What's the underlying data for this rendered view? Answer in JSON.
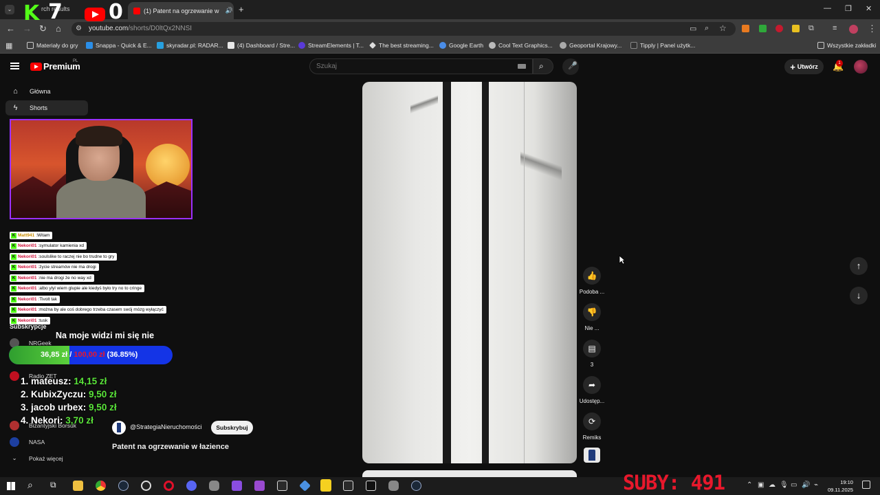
{
  "browser": {
    "tab_inactive_label": "rch results",
    "tab_active_label": "(1) Patent na ogrzewanie w",
    "url_main": "youtube.com",
    "url_path": "/shorts/D0ltQx2NNSI",
    "bookmarks": [
      "Materiały do gry",
      "Snappa - Quick & E...",
      "skyradar.pl: RADAR...",
      "(4) Dashboard / Stre...",
      "StreamElements | T...",
      "The best streaming...",
      "Google Earth",
      "Cool Text Graphics...",
      "Geoportal Krajowy...",
      "Tipply | Panel użytk..."
    ],
    "all_bookmarks": "Wszystkie zakładki"
  },
  "youtube": {
    "brand": "Premium",
    "region": "PL",
    "search_placeholder": "Szukaj",
    "create_label": "Utwórz",
    "bell_count": "1",
    "sidebar": {
      "home": "Główna",
      "shorts": "Shorts",
      "subscriptions_heading": "Subskrypcje",
      "subs": [
        "NRGeek",
        "Radio ZET",
        "Bizantyjski Borsuk",
        "NASA"
      ],
      "show_more": "Pokaż więcej"
    },
    "short": {
      "channel": "@StrategiaNieruchomości",
      "subscribe": "Subskrybuj",
      "title": "Patent na ogrzewanie w łazience"
    },
    "actions": {
      "like": "Podoba ...",
      "dislike": "Nie ...",
      "comments": "3",
      "share": "Udostęp...",
      "remix": "Remiks"
    }
  },
  "overlay": {
    "kick_count": "7",
    "kick_letter": "K",
    "yt_count": "0",
    "chat": [
      {
        "user": "Matt941",
        "msg": "Witam",
        "gold": true
      },
      {
        "user": "Nekori01",
        "msg": "symulator kamienia xd"
      },
      {
        "user": "Nekori01",
        "msg": "soulslike to raczej nie bo trudne to gry"
      },
      {
        "user": "Nekori01",
        "msg": "życie streamów nie ma drogi"
      },
      {
        "user": "Nekori01",
        "msg": "nie ma drogi że no way xd"
      },
      {
        "user": "Nekori01",
        "msg": "albo ylyl wiem glupie ale kiedyś było try no to cringe"
      },
      {
        "user": "Nekori01",
        "msg": "Tivolt tak"
      },
      {
        "user": "Nekori01",
        "msg": "można by ale coś dobrego trzeba czasem swój mózg wyłączyć"
      },
      {
        "user": "Nekori01",
        "msg": "tusk"
      }
    ],
    "goal_title": "Na moje widzi mi się nie",
    "goal_current": "36,85 zł",
    "goal_sep": "/",
    "goal_target": "100,00 zł",
    "goal_percent": "(36.85%)",
    "goal_fraction": 0.3685,
    "donors": [
      {
        "rank": "1. mateusz:",
        "amount": "14,15 zł"
      },
      {
        "rank": "2. KubixZyczu:",
        "amount": "9,50 zł"
      },
      {
        "rank": "3. jacob urbex:",
        "amount": "9,50 zł"
      },
      {
        "rank": "4. Nekori:",
        "amount": "3,70 zł"
      }
    ],
    "subs_counter": "SUBY: 491"
  },
  "taskbar": {
    "time": "19:10",
    "date": "09.11.2025"
  }
}
